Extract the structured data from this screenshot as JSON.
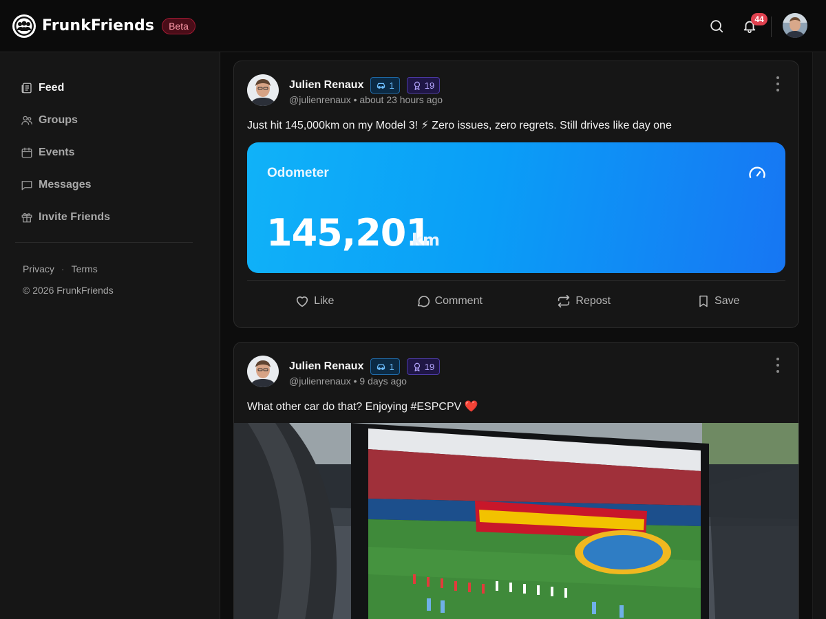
{
  "header": {
    "brand": "FrunkFriends",
    "beta_label": "Beta",
    "notification_count": "44"
  },
  "sidebar": {
    "items": [
      {
        "label": "Feed",
        "icon": "newspaper-icon",
        "active": true
      },
      {
        "label": "Groups",
        "icon": "users-icon",
        "active": false
      },
      {
        "label": "Events",
        "icon": "calendar-icon",
        "active": false
      },
      {
        "label": "Messages",
        "icon": "message-icon",
        "active": false
      },
      {
        "label": "Invite Friends",
        "icon": "gift-icon",
        "active": false
      }
    ],
    "links": {
      "privacy": "Privacy",
      "separator": "·",
      "terms": "Terms"
    },
    "copyright": "© 2026 FrunkFriends"
  },
  "posts": [
    {
      "author": "Julien Renaux",
      "car_count": "1",
      "badge_count": "19",
      "meta": "@julienrenaux • about 23 hours ago",
      "text": "Just hit 145,000km on my Model 3! ⚡  Zero issues, zero regrets. Still drives like day one",
      "odometer": {
        "title": "Odometer",
        "value": "145,201",
        "unit": "km"
      },
      "actions": {
        "like": "Like",
        "comment": "Comment",
        "repost": "Repost",
        "save": "Save"
      }
    },
    {
      "author": "Julien Renaux",
      "car_count": "1",
      "badge_count": "19",
      "meta": "@julienrenaux • 9 days ago",
      "text": "What other car do that? Enjoying #ESPCPV ❤️"
    }
  ],
  "colors": {
    "accent_blue": "#0a9ef7",
    "beta_red": "#a21a33",
    "notification_red": "#e0414f"
  }
}
